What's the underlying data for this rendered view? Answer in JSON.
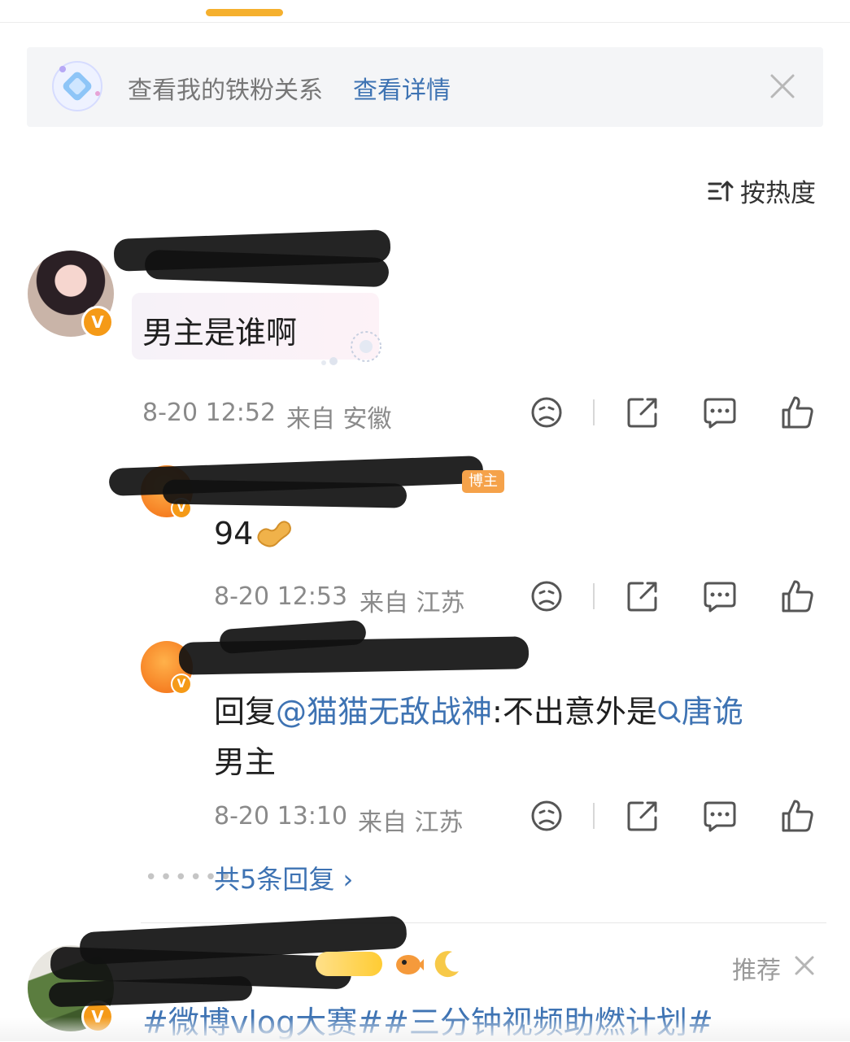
{
  "banner": {
    "text": "查看我的铁粉关系",
    "link": "查看详情"
  },
  "sort": {
    "label": "按热度"
  },
  "comments": [
    {
      "text": "男主是谁啊",
      "time": "8-20 12:52",
      "from": "来自 安徽"
    }
  ],
  "replies": [
    {
      "badge": "博主",
      "text": "94",
      "time": "8-20 12:53",
      "from": "来自 江苏"
    },
    {
      "text_prefix": "回复",
      "mention": "@猫猫无敌战神",
      "text_mid": ":不出意外是",
      "keyword": "唐诡",
      "text_line2": "男主",
      "time": "8-20 13:10",
      "from": "来自 江苏"
    }
  ],
  "more_replies": "共5条回复 ›",
  "next_comment": {
    "tag": "推荐",
    "text": "#微博vlog大赛##三分钟视频助燃计划#"
  },
  "icons": [
    "diamond-icon",
    "close-icon",
    "sort-icon",
    "dislike-icon",
    "share-icon",
    "comment-icon",
    "like-icon",
    "search-icon",
    "peanut-icon"
  ],
  "colors": {
    "accent": "#f5b02e",
    "link": "#3e73b3",
    "meta": "#8a8a8a"
  }
}
